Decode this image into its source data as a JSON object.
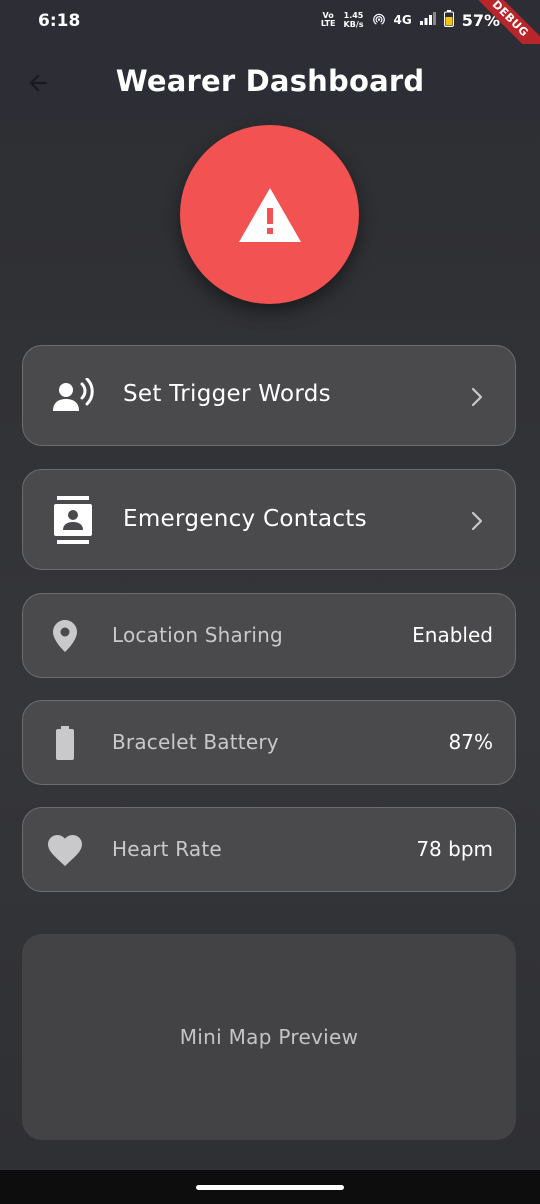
{
  "status_bar": {
    "time": "6:18",
    "volte_line1": "Vo",
    "volte_line2": "LTE",
    "speed_value": "1.45",
    "speed_unit": "KB/s",
    "network": "4G",
    "battery": "57%"
  },
  "debug_banner": "DEBUG",
  "app_bar": {
    "title": "Wearer Dashboard",
    "back_icon": "arrow-left-icon"
  },
  "sos_button": {
    "icon": "warning-icon",
    "color": "#f25352"
  },
  "menu_items": [
    {
      "label": "Set Trigger Words",
      "icon": "record-voice-icon"
    },
    {
      "label": "Emergency Contacts",
      "icon": "contacts-icon"
    }
  ],
  "status_items": [
    {
      "label": "Location Sharing",
      "value": "Enabled",
      "icon": "location-pin-icon"
    },
    {
      "label": "Bracelet Battery",
      "value": "87%",
      "icon": "battery-icon"
    },
    {
      "label": "Heart Rate",
      "value": "78 bpm",
      "icon": "heart-icon"
    }
  ],
  "mini_map": {
    "label": "Mini Map Preview"
  },
  "colors": {
    "accent": "#f25352",
    "background": "#2b2c30",
    "card": "#4a4a4c"
  }
}
